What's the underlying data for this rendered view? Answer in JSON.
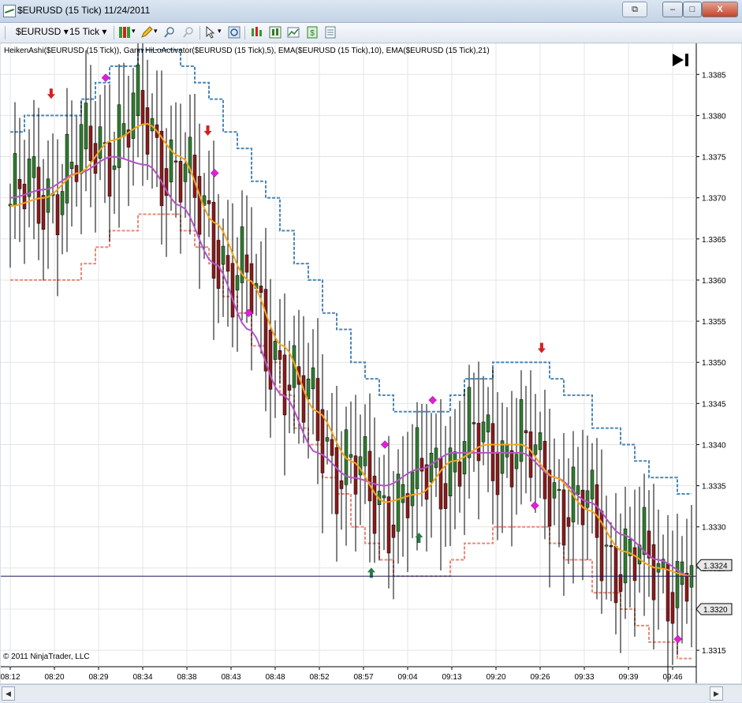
{
  "window": {
    "title": "$EURUSD (15 Tick)  11/24/2011",
    "restore_label": "⧉",
    "minimize_label": "–",
    "maximize_label": "□",
    "close_label": "X"
  },
  "toolbar": {
    "instrument": "$EURUSD",
    "period": "15 Tick",
    "dropdown_glyph": "▾"
  },
  "chart": {
    "indicators_label": "HeikenAshi($EURUSD (15 Tick)), Gann HiLoActivator($EURUSD (15 Tick),5), EMA($EURUSD (15 Tick),10), EMA($EURUSD (15 Tick),21)",
    "copyright": "© 2011 NinjaTrader, LLC",
    "last_price_label": "1.3324",
    "low_marker_label": "1.3320",
    "colors": {
      "up_candle": "#2f7d2f",
      "down_candle": "#8b1a1a",
      "ema10": "#f0a520",
      "ema21": "#b455c8",
      "hilo_high": "#4a86b8",
      "hilo_low": "#e88a7a",
      "marker": "#e020d8",
      "signal_down": "#d42020",
      "signal_up": "#2a7a4a",
      "price_line": "#1a1a5a"
    }
  },
  "chart_data": {
    "type": "line",
    "yticks": [
      "1.3315",
      "1.3320",
      "1.3325",
      "1.3330",
      "1.3335",
      "1.3340",
      "1.3345",
      "1.3350",
      "1.3355",
      "1.3360",
      "1.3365",
      "1.3370",
      "1.3375",
      "1.3380",
      "1.3385"
    ],
    "ylim": [
      1.3313,
      1.3388
    ],
    "xticks": [
      "08:12",
      "08:20",
      "08:29",
      "08:34",
      "08:38",
      "08:43",
      "08:48",
      "08:52",
      "08:57",
      "09:04",
      "09:13",
      "09:20",
      "09:26",
      "09:33",
      "09:39",
      "09:46"
    ],
    "ema10": [
      1.3369,
      1.337,
      1.3373,
      1.3377,
      1.3379,
      1.3375,
      1.3367,
      1.336,
      1.3352,
      1.3344,
      1.3338,
      1.3333,
      1.3334,
      1.3338,
      1.334,
      1.334,
      1.3336,
      1.3332,
      1.3327,
      1.3325,
      1.3324
    ],
    "ema21": [
      1.337,
      1.3371,
      1.3373,
      1.3375,
      1.3374,
      1.3369,
      1.3362,
      1.3354,
      1.3346,
      1.3339,
      1.3336,
      1.3335,
      1.3337,
      1.3339,
      1.3339,
      1.3339,
      1.3336,
      1.3333,
      1.3329,
      1.3326,
      1.3324
    ],
    "last_price": 1.3324
  }
}
